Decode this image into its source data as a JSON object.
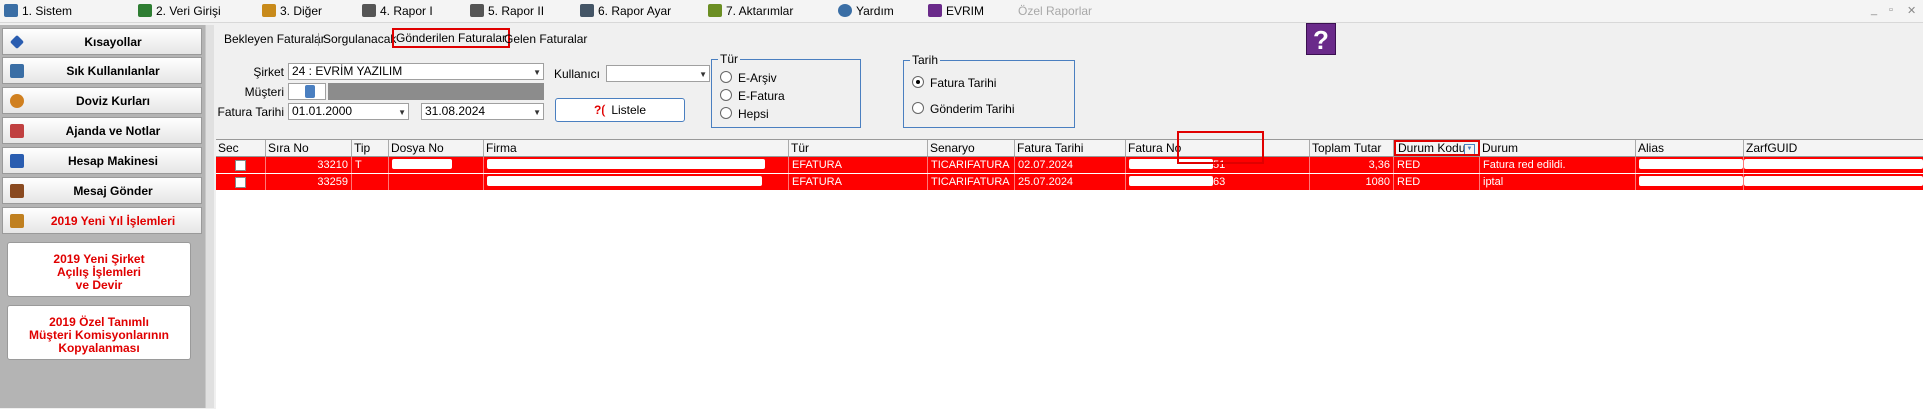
{
  "menu": [
    {
      "label": "1.  Sistem",
      "icon": "system-icon",
      "color": "#3a6ea5"
    },
    {
      "label": "2.  Veri Girişi",
      "icon": "data-entry-icon",
      "color": "#2e7d32"
    },
    {
      "label": "3.  Diğer",
      "icon": "other-icon",
      "color": "#c88a1a"
    },
    {
      "label": "4.   Rapor I",
      "icon": "printer-icon",
      "color": "#555555"
    },
    {
      "label": "5.   Rapor II",
      "icon": "printer-icon",
      "color": "#555555"
    },
    {
      "label": "6.   Rapor Ayar",
      "icon": "report-settings-icon",
      "color": "#445566"
    },
    {
      "label": "7.  Aktarımlar",
      "icon": "transfer-icon",
      "color": "#6b8e23"
    },
    {
      "label": "Yardım",
      "icon": "help-icon",
      "color": "#3a6ea5"
    },
    {
      "label": "EVRIM",
      "icon": "evrim-icon",
      "color": "#6a2a8a"
    },
    {
      "label": "Özel Raporlar",
      "icon": "",
      "disabled": true
    }
  ],
  "window_controls": [
    "_",
    "▫",
    "✕"
  ],
  "sidebar": {
    "buttons": [
      {
        "label": "Kısayollar",
        "icon": "shortcut-icon",
        "color": "#2a5db0"
      },
      {
        "label": "Sık Kullanılanlar",
        "icon": "favorites-icon",
        "color": "#3a6ea5"
      },
      {
        "label": "Doviz Kurları",
        "icon": "currency-icon",
        "color": "#d08020"
      },
      {
        "label": "Ajanda ve Notlar",
        "icon": "agenda-icon",
        "color": "#c04040"
      },
      {
        "label": "Hesap Makinesi",
        "icon": "calculator-icon",
        "color": "#2a5db0"
      },
      {
        "label": "Mesaj Gönder",
        "icon": "message-icon",
        "color": "#8a4a20"
      },
      {
        "label": "2019 Yeni Yıl İşlemleri",
        "icon": "new-year-icon",
        "color": "#c08020",
        "red": true
      }
    ],
    "boxes": [
      {
        "lines": [
          "2019 Yeni Şirket",
          "Açılış İşlemleri",
          "ve Devir"
        ]
      },
      {
        "lines": [
          "2019 Özel Tanımlı",
          "Müşteri Komisyonlarının",
          "Kopyalanması"
        ]
      }
    ]
  },
  "tabs": [
    "Bekleyen Faturalar",
    "Sorgulanacak",
    "Gönderilen Faturalar",
    "Gelen Faturalar"
  ],
  "active_tab": "Gönderilen Faturalar",
  "help_button": "?",
  "form": {
    "sirket_label": "Şirket",
    "sirket_value": "24 : EVRİM YAZILIM",
    "musteri_label": "Müşteri",
    "fatura_tarihi_label": "Fatura Tarihi",
    "date_from": "01.01.2000",
    "date_to": "31.08.2024",
    "kullanici_label": "Kullanıcı",
    "kullanici_value": "",
    "listele_label": "Listele"
  },
  "tur_group": {
    "title": "Tür",
    "options": [
      "E-Arşiv",
      "E-Fatura",
      "Hepsi"
    ],
    "selected": null
  },
  "tarih_group": {
    "title": "Tarih",
    "options": [
      "Fatura Tarihi",
      "Gönderim Tarihi"
    ],
    "selected": "Fatura Tarihi"
  },
  "grid": {
    "columns": [
      "Sec",
      "Sıra No",
      "Tip",
      "Dosya No",
      "Firma",
      "Tür",
      "Senaryo",
      "Fatura Tarihi",
      "Fatura No",
      "Toplam Tutar",
      "Durum Kodu",
      "Durum",
      "Alias",
      "ZarfGUID"
    ],
    "rows": [
      {
        "sira_no": "33210",
        "tip": "T",
        "tur": "EFATURA",
        "senaryo": "TICARIFATURA",
        "fatura_tarihi": "02.07.2024",
        "fatura_no_suffix": "51",
        "toplam": "3,36",
        "durum_kodu": "RED",
        "durum": "Fatura red edildi."
      },
      {
        "sira_no": "33259",
        "tip": "",
        "tur": "EFATURA",
        "senaryo": "TICARIFATURA",
        "fatura_tarihi": "25.07.2024",
        "fatura_no_suffix": "63",
        "toplam": "1080",
        "durum_kodu": "RED",
        "durum": "iptal"
      }
    ],
    "row_color": "#ff0000"
  }
}
